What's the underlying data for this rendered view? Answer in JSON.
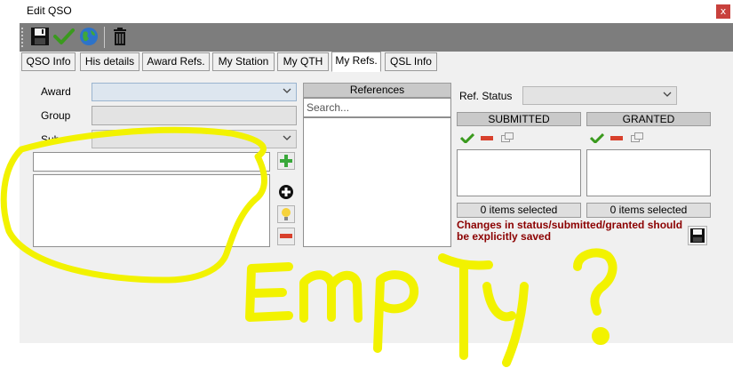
{
  "window": {
    "title": "Edit QSO",
    "close_label": "x"
  },
  "tabs": [
    {
      "label": "QSO Info"
    },
    {
      "label": "His details"
    },
    {
      "label": "Award Refs."
    },
    {
      "label": "My Station"
    },
    {
      "label": "My QTH"
    },
    {
      "label": "My Refs.",
      "active": true
    },
    {
      "label": "QSL Info"
    }
  ],
  "form": {
    "award_label": "Award",
    "group_label": "Group",
    "sub_label": "Sub",
    "award_value": "",
    "group_value": "",
    "sub_value": ""
  },
  "references": {
    "header": "References",
    "search_placeholder": "Search..."
  },
  "status": {
    "ref_status_label": "Ref. Status",
    "ref_status_value": "",
    "submitted_header": "SUBMITTED",
    "granted_header": "GRANTED",
    "submitted_count": "0 items selected",
    "granted_count": "0 items selected",
    "warning": "Changes in status/submitted/granted should be explicitly saved"
  },
  "annotation": {
    "text": "Empty ?",
    "color": "#f2f200"
  },
  "colors": {
    "toolbar": "#7d7d7d",
    "warning": "#8b0000",
    "close": "#c8403c"
  }
}
